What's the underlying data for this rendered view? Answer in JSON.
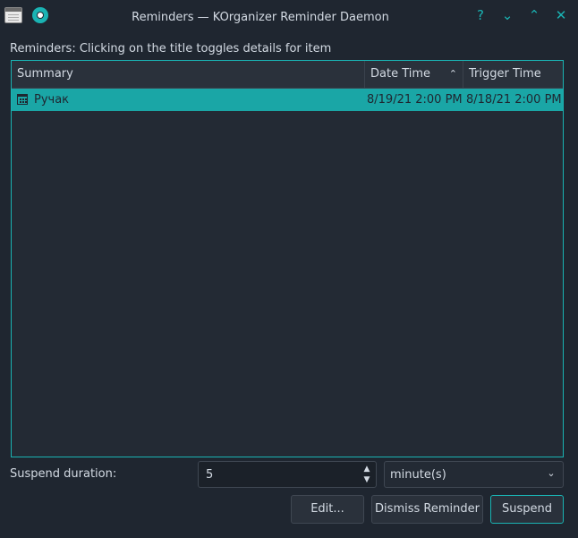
{
  "window": {
    "title": "Reminders — KOrganizer Reminder Daemon",
    "help_glyph": "?",
    "minimize_glyph": "⌄",
    "maximize_glyph": "⌃",
    "close_glyph": "✕"
  },
  "heading": "Reminders: Clicking on the title toggles details for item",
  "list": {
    "columns": [
      "Summary",
      "Date Time",
      "Trigger Time"
    ],
    "sort_indicator": "⌃",
    "rows": [
      {
        "summary": "Ручак",
        "date_time": "8/19/21 2:00 PM",
        "trigger_time": "8/18/21 2:00 PM",
        "icon": "calendar-icon"
      }
    ]
  },
  "suspend": {
    "label": "Suspend duration:",
    "value": "5",
    "unit": "minute(s)"
  },
  "buttons": {
    "edit": "Edit...",
    "dismiss": "Dismiss Reminder",
    "suspend": "Suspend"
  },
  "colors": {
    "accent": "#1ab3b3",
    "selection": "#1aa6a6",
    "background": "#1f2630"
  }
}
